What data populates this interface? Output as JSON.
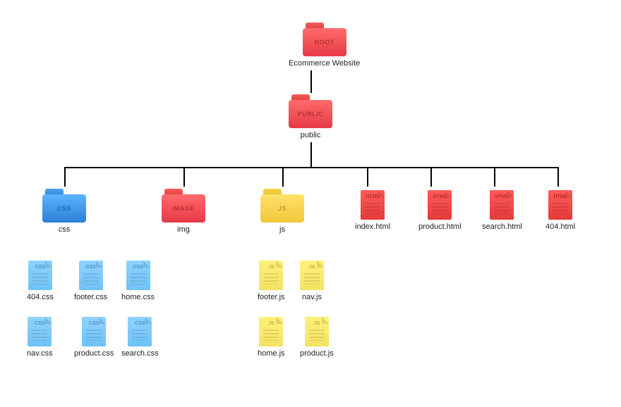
{
  "root": {
    "badge": "ROOT",
    "label": "Ecommerce Website"
  },
  "public": {
    "badge": "PUBLIC",
    "label": "public"
  },
  "css_folder": {
    "badge": "CSS",
    "label": "css"
  },
  "img_folder": {
    "badge": "IMAGE",
    "label": "img"
  },
  "js_folder": {
    "badge": "JS",
    "label": "js"
  },
  "html_files": {
    "badge": "HTML",
    "items": [
      "index.html",
      "product.html",
      "search.html",
      "404.html"
    ]
  },
  "css_files": {
    "badge": "CSS",
    "items": [
      "404.css",
      "footer.css",
      "home.css",
      "nav.css",
      "product.css",
      "search.css"
    ]
  },
  "js_files": {
    "badge": "JS",
    "items": [
      "footer.js",
      "nav.js",
      "home.js",
      "product.js"
    ]
  }
}
